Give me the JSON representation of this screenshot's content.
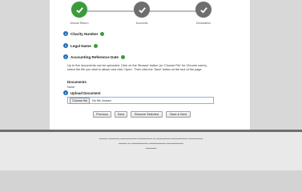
{
  "stepper": {
    "steps": [
      {
        "label": "Annual Return",
        "state": "complete"
      },
      {
        "label": "Accounts",
        "state": "done"
      },
      {
        "label": "Declaration",
        "state": "done"
      }
    ]
  },
  "fields": {
    "charity_number": "Charity Number",
    "legal_name": "Legal Name",
    "accounting_reference_date": "Accounting Reference Date"
  },
  "instructions": "Up to five documents can be uploaded. Click on the 'Browse' button (or 'Choose File' for Chrome users), select the file you wish to attach and click 'Open'. Then click the 'Save' button at the foot of the page.",
  "documents": {
    "heading": "Documents",
    "value": "None"
  },
  "upload": {
    "label": "Upload Document",
    "choose_label": "Choose file",
    "status": "No file chosen"
  },
  "buttons": {
    "previous": "Previous",
    "save": "Save",
    "remove_selected": "Remove Selected",
    "save_next": "Save & Next"
  },
  "colors": {
    "step_complete": "#3a9b3a",
    "step_done": "#6e6e6e",
    "info_icon": "#1f6fb5"
  }
}
